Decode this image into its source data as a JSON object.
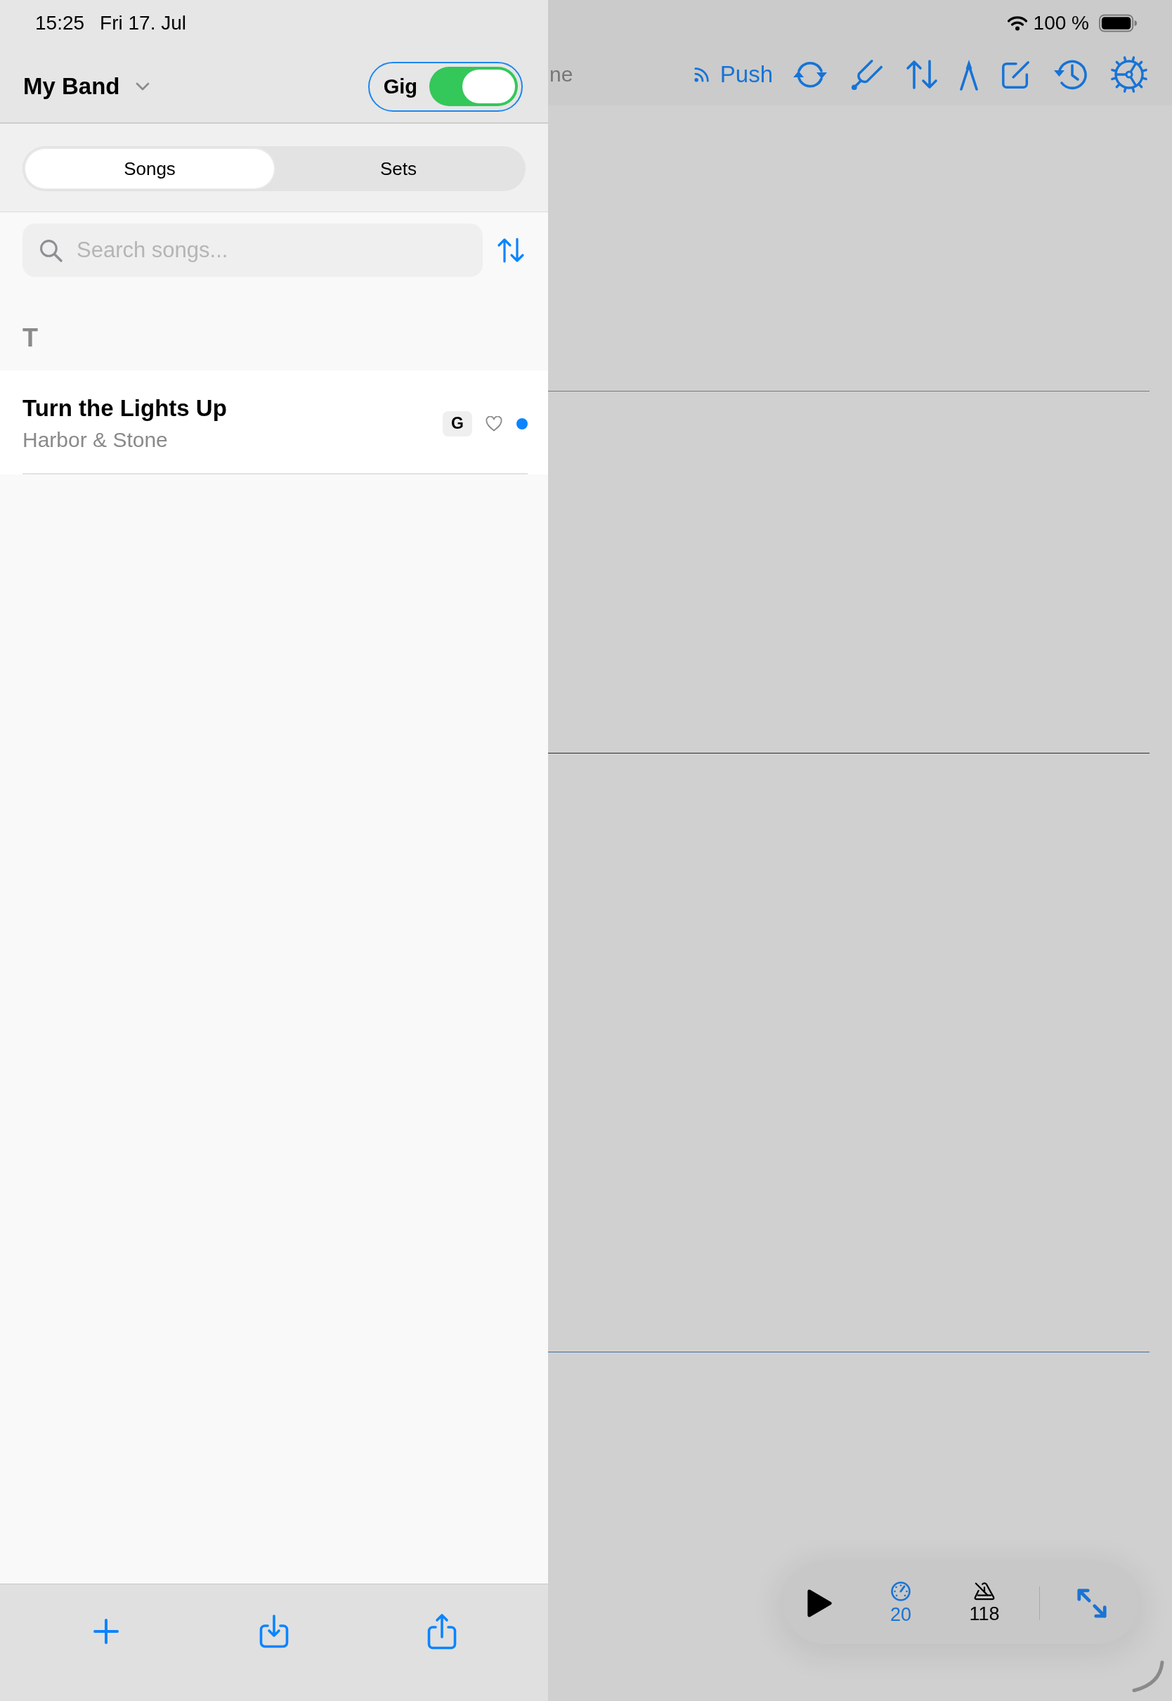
{
  "status_bar": {
    "time": "15:25",
    "date": "Fri 17. Jul",
    "battery": "100 %"
  },
  "sidebar": {
    "band": "My Band",
    "gig_toggle": {
      "label": "Gig",
      "on": true
    },
    "segments": [
      {
        "label": "Songs",
        "selected": true
      },
      {
        "label": "Sets",
        "selected": false
      }
    ],
    "search": {
      "placeholder": "Search songs..."
    },
    "sections": [
      {
        "letter": "T",
        "songs": [
          {
            "title": "Turn the Lights Up",
            "artist": "Harbor & Stone",
            "key": "G",
            "favorite": false,
            "unread": true
          }
        ]
      }
    ]
  },
  "toolbar": {
    "title": "ne",
    "push": "Push"
  },
  "player": {
    "speed": "20",
    "tempo": "118"
  }
}
